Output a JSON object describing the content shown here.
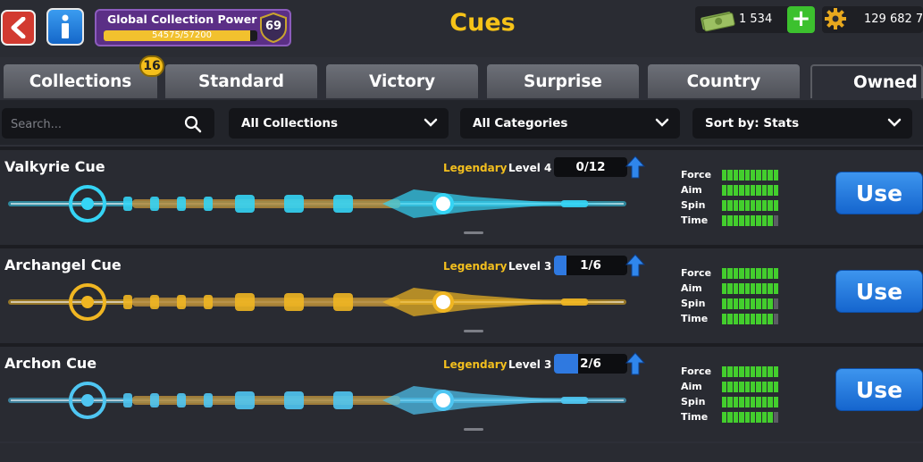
{
  "header": {
    "title": "Cues",
    "collection_power": {
      "label": "Global Collection Power",
      "value": "54575/57200",
      "progress": 0.954,
      "level": "69"
    },
    "cash": "1 534",
    "coins": "129 682 7"
  },
  "tabs": [
    {
      "label": "Collections",
      "badge": "16"
    },
    {
      "label": "Standard"
    },
    {
      "label": "Victory"
    },
    {
      "label": "Surprise"
    },
    {
      "label": "Country"
    },
    {
      "label": "Owned",
      "active": true
    }
  ],
  "filters": {
    "search_placeholder": "Search...",
    "collection": "All Collections",
    "category": "All Categories",
    "sort": "Sort by: Stats"
  },
  "stat_labels": [
    "Force",
    "Aim",
    "Spin",
    "Time"
  ],
  "cues": [
    {
      "name": "Valkyrie Cue",
      "rarity": "Legendary",
      "level": "Level 4",
      "progress": "0/12",
      "progress_fraction": 0.0,
      "stats": [
        10,
        10,
        10,
        9
      ],
      "use_label": "Use",
      "theme": "#35d4f5"
    },
    {
      "name": "Archangel Cue",
      "rarity": "Legendary",
      "level": "Level 3",
      "progress": "1/6",
      "progress_fraction": 0.167,
      "stats": [
        10,
        10,
        9,
        9
      ],
      "use_label": "Use",
      "theme": "#f0b622"
    },
    {
      "name": "Archon Cue",
      "rarity": "Legendary",
      "level": "Level 3",
      "progress": "2/6",
      "progress_fraction": 0.333,
      "stats": [
        10,
        10,
        10,
        9
      ],
      "use_label": "Use",
      "theme": "#4fc6f2"
    }
  ],
  "colors": {
    "accent": "#f6c318",
    "stat_on": "#43ce2d",
    "button": "#1e74dc"
  }
}
